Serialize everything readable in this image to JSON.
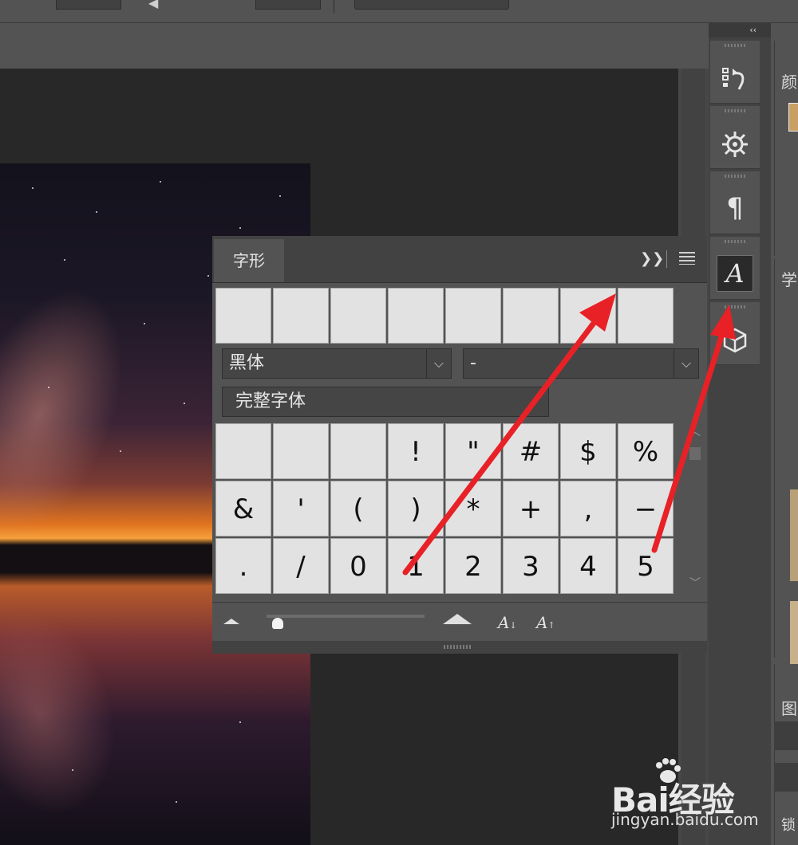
{
  "glyphs_panel": {
    "tab_label": "字形",
    "expand_icon": "double-chevron-right-icon",
    "menu_icon": "hamburger-menu-icon",
    "font_family": "黑体",
    "font_style": "-",
    "category": "完整字体",
    "glyph_rows": [
      [
        "",
        "",
        "",
        "!",
        "\"",
        "#",
        "$",
        "%"
      ],
      [
        "&",
        "'",
        "(",
        ")",
        "*",
        "+",
        ",",
        "−"
      ],
      [
        ".",
        "/",
        "0",
        "1",
        "2",
        "3",
        "4",
        "5"
      ]
    ],
    "zoom_out_icon": "small-mountain-icon",
    "zoom_in_icon": "large-mountain-icon",
    "size_down_label": "A",
    "size_up_label": "A"
  },
  "dock": {
    "collapse_label": "‹‹",
    "icons": [
      "history-icon",
      "navigator-icon",
      "paragraph-icon",
      "glyphs-icon",
      "3d-icon"
    ],
    "paragraph_glyph": "¶",
    "glyphs_glyph": "A"
  },
  "right_panel": {
    "text_1": "颜",
    "text_2": "学",
    "text_3": "图",
    "text_4": "锁"
  },
  "watermark": {
    "brand": "Bai经验",
    "url": "jingyan.baidu.com"
  },
  "colors": {
    "arrow": "#e82127",
    "panel": "#535353",
    "canvas": "#282828"
  }
}
